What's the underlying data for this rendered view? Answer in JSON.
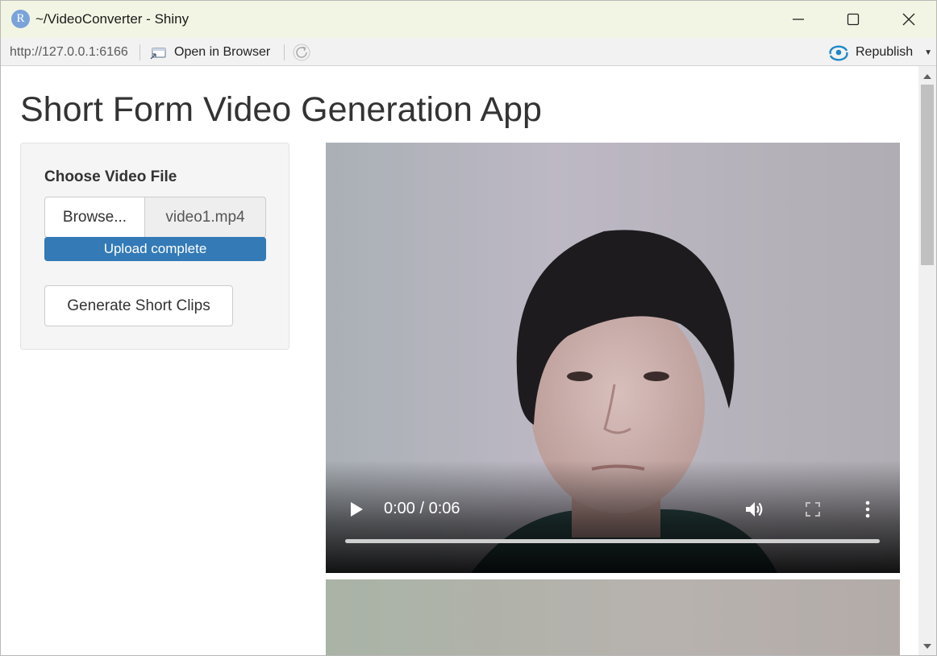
{
  "window": {
    "title": "~/VideoConverter - Shiny",
    "logo_letter": "R"
  },
  "toolbar": {
    "url": "http://127.0.0.1:6166",
    "open_in_browser_label": "Open in Browser",
    "republish_label": "Republish"
  },
  "app": {
    "title": "Short Form Video Generation App",
    "file_input": {
      "label": "Choose Video File",
      "browse_label": "Browse...",
      "file_name": "video1.mp4",
      "progress_text": "Upload complete",
      "progress_fraction": 1.0
    },
    "generate_button_label": "Generate Short Clips"
  },
  "video_player": {
    "time_display": "0:00 / 0:06",
    "playback_fraction": 0.0
  },
  "colors": {
    "titlebar_bg": "#f3f5e4",
    "progress_blue": "#337ab7",
    "republish_icon": "#1e88c8",
    "r_logo": "#7aa3d9"
  },
  "icons": {
    "logo": "r-logo-icon",
    "minimize": "minimize-icon",
    "maximize": "maximize-icon",
    "close": "close-icon",
    "open_browser": "open-in-browser-icon",
    "refresh": "refresh-icon",
    "republish": "republish-icon",
    "play": "play-icon",
    "volume": "volume-icon",
    "fullscreen": "fullscreen-icon",
    "more": "more-options-icon"
  }
}
